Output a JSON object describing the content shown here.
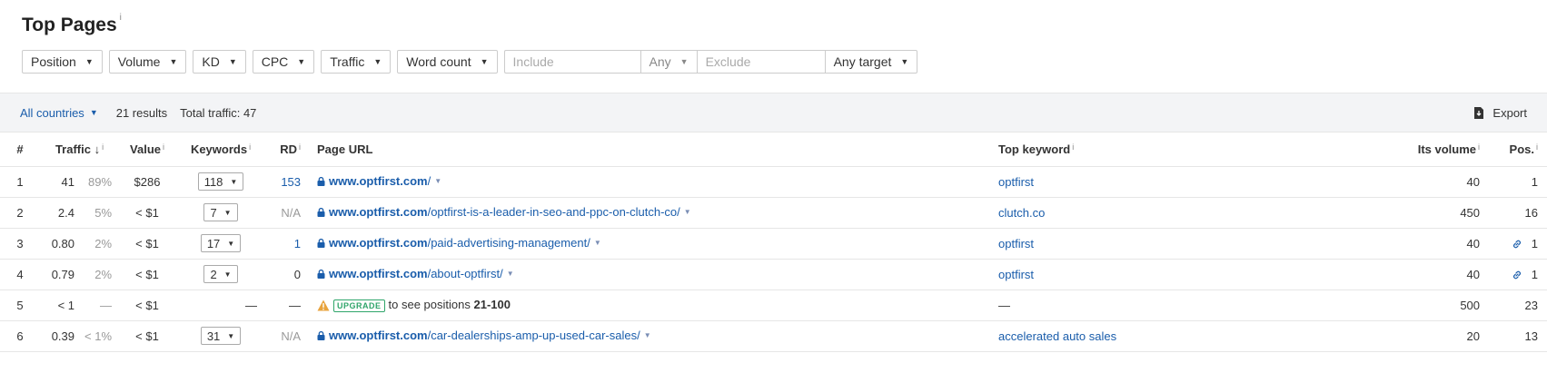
{
  "page": {
    "title": "Top Pages",
    "title_info": "i"
  },
  "filters": {
    "position": "Position",
    "volume": "Volume",
    "kd": "KD",
    "cpc": "CPC",
    "traffic": "Traffic",
    "word_count": "Word count",
    "include_placeholder": "Include",
    "include_match": "Any",
    "exclude_placeholder": "Exclude",
    "target": "Any target"
  },
  "toolbar": {
    "countries": "All countries",
    "results": "21 results",
    "total_traffic": "Total traffic: 47",
    "export": "Export"
  },
  "table": {
    "headers": {
      "num": "#",
      "traffic": "Traffic",
      "value": "Value",
      "keywords": "Keywords",
      "rd": "RD",
      "page_url": "Page URL",
      "top_keyword": "Top keyword",
      "its_volume": "Its volume",
      "pos": "Pos.",
      "info": "i",
      "sort_arrow": "↓"
    },
    "rows": [
      {
        "num": "1",
        "traffic": "41",
        "pct": "89%",
        "value": "$286",
        "keywords": "118",
        "rd": "153",
        "domain": "www.optfirst.com",
        "path": "/",
        "top_keyword": "optfirst",
        "volume": "40",
        "pos": "1"
      },
      {
        "num": "2",
        "traffic": "2.4",
        "pct": "5%",
        "value": "< $1",
        "keywords": "7",
        "rd": "N/A",
        "domain": "www.optfirst.com",
        "path": "/optfirst-is-a-leader-in-seo-and-ppc-on-clutch-co/",
        "top_keyword": "clutch.co",
        "volume": "450",
        "pos": "16"
      },
      {
        "num": "3",
        "traffic": "0.80",
        "pct": "2%",
        "value": "< $1",
        "keywords": "17",
        "rd": "1",
        "domain": "www.optfirst.com",
        "path": "/paid-advertising-management/",
        "top_keyword": "optfirst",
        "volume": "40",
        "pos": "1"
      },
      {
        "num": "4",
        "traffic": "0.79",
        "pct": "2%",
        "value": "< $1",
        "keywords": "2",
        "rd": "0",
        "domain": "www.optfirst.com",
        "path": "/about-optfirst/",
        "top_keyword": "optfirst",
        "volume": "40",
        "pos": "1"
      },
      {
        "num": "5",
        "traffic": "< 1",
        "pct": "—",
        "value": "< $1",
        "keywords": "—",
        "rd": "—",
        "upgrade_badge": "UPGRADE",
        "upgrade_text": "to see positions",
        "upgrade_range": "21-100",
        "top_keyword": "—",
        "volume": "500",
        "pos": "23"
      },
      {
        "num": "6",
        "traffic": "0.39",
        "pct": "< 1%",
        "value": "< $1",
        "keywords": "31",
        "rd": "N/A",
        "domain": "www.optfirst.com",
        "path": "/car-dealerships-amp-up-used-car-sales/",
        "top_keyword": "accelerated auto sales",
        "volume": "20",
        "pos": "13"
      }
    ]
  },
  "colors": {
    "link": "#1a5dab",
    "muted": "#999999",
    "upgrade": "#2fa56a",
    "warning": "#e8a33d",
    "toolbar_bg": "#f3f4f6"
  }
}
